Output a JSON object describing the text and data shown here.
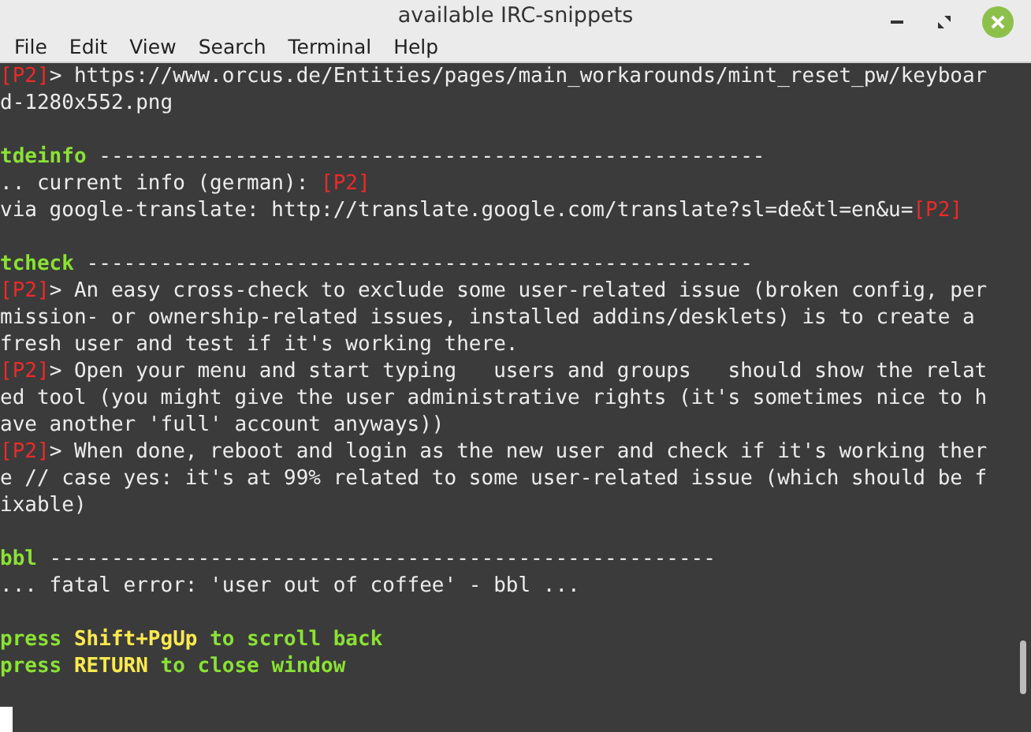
{
  "window": {
    "title": "available IRC-snippets"
  },
  "menu": [
    "File",
    "Edit",
    "View",
    "Search",
    "Terminal",
    "Help"
  ],
  "blocks": [
    [
      [
        {
          "kind": "tag",
          "text": "[P2]"
        },
        {
          "kind": "text",
          "text": "> https://www.orcus.de/Entities/pages/main_workarounds/mint_reset_pw/keyboar"
        }
      ],
      [
        {
          "kind": "text",
          "text": "d-1280x552.png"
        }
      ]
    ],
    [
      [
        {
          "kind": "heading",
          "text": "tdeinfo"
        },
        {
          "kind": "text",
          "text": " ------------------------------------------------------"
        }
      ],
      [
        {
          "kind": "text",
          "text": ".. current info (german): "
        },
        {
          "kind": "tag",
          "text": "[P2]"
        }
      ],
      [
        {
          "kind": "text",
          "text": "via google-translate: http://translate.google.com/translate?sl=de&tl=en&u="
        },
        {
          "kind": "tag",
          "text": "[P2]"
        }
      ]
    ],
    [
      [
        {
          "kind": "heading",
          "text": "tcheck"
        },
        {
          "kind": "text",
          "text": " ------------------------------------------------------"
        }
      ],
      [
        {
          "kind": "tag",
          "text": "[P2]"
        },
        {
          "kind": "text",
          "text": "> An easy cross-check to exclude some user-related issue (broken config, per"
        }
      ],
      [
        {
          "kind": "text",
          "text": "mission- or ownership-related issues, installed addins/desklets) is to create a"
        }
      ],
      [
        {
          "kind": "text",
          "text": "fresh user and test if it's working there."
        }
      ],
      [
        {
          "kind": "tag",
          "text": "[P2]"
        },
        {
          "kind": "text",
          "text": "> Open your menu and start typing   users and groups   should show the relat"
        }
      ],
      [
        {
          "kind": "text",
          "text": "ed tool (you might give the user administrative rights (it's sometimes nice to h"
        }
      ],
      [
        {
          "kind": "text",
          "text": "ave another 'full' account anyways))"
        }
      ],
      [
        {
          "kind": "tag",
          "text": "[P2]"
        },
        {
          "kind": "text",
          "text": "> When done, reboot and login as the new user and check if it's working ther"
        }
      ],
      [
        {
          "kind": "text",
          "text": "e // case yes: it's at 99% related to some user-related issue (which should be f"
        }
      ],
      [
        {
          "kind": "text",
          "text": "ixable)"
        }
      ]
    ],
    [
      [
        {
          "kind": "heading",
          "text": "bbl"
        },
        {
          "kind": "text",
          "text": " ------------------------------------------------------"
        }
      ],
      [
        {
          "kind": "text",
          "text": "... fatal error: 'user out of coffee' - bbl ..."
        }
      ]
    ],
    [
      [
        {
          "kind": "prompt",
          "text": "press "
        },
        {
          "kind": "key",
          "text": "Shift+PgUp"
        },
        {
          "kind": "prompt",
          "text": " to scroll back"
        }
      ],
      [
        {
          "kind": "prompt",
          "text": "press "
        },
        {
          "kind": "key",
          "text": "RETURN"
        },
        {
          "kind": "prompt",
          "text": " to close window"
        }
      ]
    ]
  ]
}
